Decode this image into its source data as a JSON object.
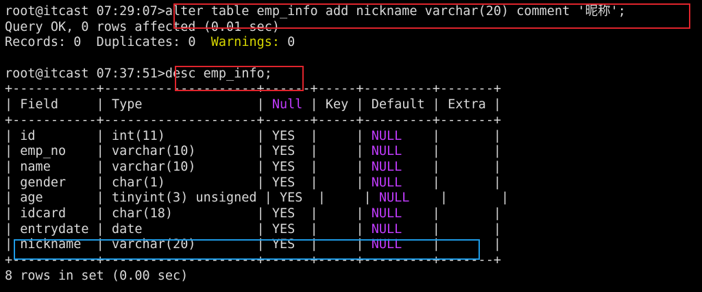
{
  "session": {
    "cmd1": {
      "prompt": "root@itcast 07:29:07>",
      "sql": "alter table emp_info add nickname varchar(20) comment '昵称';"
    },
    "result1": {
      "line1": "Query OK, 0 rows affected (0.01 sec)",
      "records_label": "Records:",
      "records_value": "0",
      "duplicates_label": "Duplicates:",
      "duplicates_value": "0",
      "warnings_label": "Warnings:",
      "warnings_value": "0"
    },
    "cmd2": {
      "prompt": "root@itcast 07:37:51>",
      "sql": "desc emp_info;"
    },
    "table": {
      "border": "+-----------+--------------------+------+-----+---------+-------+",
      "headers": [
        "Field",
        "Type",
        "Null",
        "Key",
        "Default",
        "Extra"
      ],
      "rows": [
        [
          "id",
          "int(11)",
          "YES",
          "",
          "NULL",
          ""
        ],
        [
          "emp_no",
          "varchar(10)",
          "YES",
          "",
          "NULL",
          ""
        ],
        [
          "name",
          "varchar(10)",
          "YES",
          "",
          "NULL",
          ""
        ],
        [
          "gender",
          "char(1)",
          "YES",
          "",
          "NULL",
          ""
        ],
        [
          "age",
          "tinyint(3) unsigned",
          "YES",
          "",
          "NULL",
          ""
        ],
        [
          "idcard",
          "char(18)",
          "YES",
          "",
          "NULL",
          ""
        ],
        [
          "entrydate",
          "date",
          "YES",
          "",
          "NULL",
          ""
        ],
        [
          "nickname",
          "varchar(20)",
          "YES",
          "",
          "NULL",
          ""
        ]
      ]
    },
    "footer": "8 rows in set (0.00 sec)"
  },
  "colors": {
    "background": "#000000",
    "text": "#d9d9d9",
    "warning_label": "#d7d700",
    "null_value": "#c23cff",
    "highlight_red": "#e0242c",
    "highlight_blue": "#1e9be6"
  }
}
